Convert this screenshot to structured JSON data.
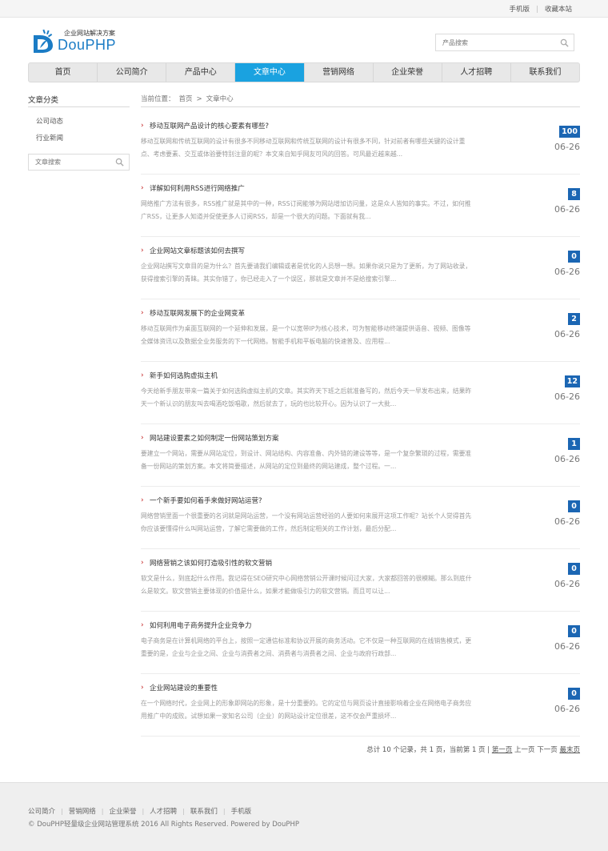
{
  "topbar": {
    "mobile": "手机版",
    "bookmark": "收藏本站"
  },
  "logo": {
    "tagline": "企业网站解决方案",
    "brand": "DouPHP"
  },
  "header_search": {
    "placeholder": "产品搜索"
  },
  "nav": [
    "首页",
    "公司简介",
    "产品中心",
    "文章中心",
    "营销网络",
    "企业荣誉",
    "人才招聘",
    "联系我们"
  ],
  "nav_active_index": 3,
  "sidebar": {
    "title": "文章分类",
    "items": [
      "公司动态",
      "行业新闻"
    ],
    "search_placeholder": "文章搜索"
  },
  "breadcrumb": {
    "prefix": "当前位置：",
    "home": "首页",
    "sep": ">",
    "current": "文章中心"
  },
  "articles": [
    {
      "title": "移动互联网产品设计的核心要素有哪些?",
      "desc": "移动互联网和传统互联网的设计有很多不同移动互联网和传统互联网的设计有很多不同，针对前者有哪些关键的设计重点、考虑要素、交互或体验要特别注意的呢？本文来自知乎网友可风的回答。可风最近越来越...",
      "count": "100",
      "date": "06-26"
    },
    {
      "title": "详解如何利用RSS进行网络推广",
      "desc": "网络推广方法有很多，RSS推广就是其中的一种，RSS订阅能够为网站增加访问量，这是众人皆知的事实。不过，如何推广RSS，让更多人知道并促使更多人订阅RSS，却是一个很大的问题。下面就有我...",
      "count": "8",
      "date": "06-26"
    },
    {
      "title": "企业网站文章标题该如何去撰写",
      "desc": "企业网站撰写文章目的是为什么？首先要请我们编辑或者是优化的人员想一想。如果你说只是为了更新，为了网站收录，获得搜索引擎的青睐。其实你错了，你已经走入了一个误区，那就是文章并不是给搜索引擎...",
      "count": "0",
      "date": "06-26"
    },
    {
      "title": "移动互联网发展下的企业网变革",
      "desc": "移动互联网作为桌面互联网的一个延伸和发展，是一个以宽带IP为核心技术，可为智能移动终端提供语音、视频、图像等全媒体资讯以及数据全业务服务的下一代网络。智能手机和平板电脑的快速普及、应用程...",
      "count": "2",
      "date": "06-26"
    },
    {
      "title": "新手如何选购虚拟主机",
      "desc": "今天给新手朋友带来一篇关于如何选购虚拟主机的文章。其实昨天下班之后就准备写的，然后今天一早发布出来，结果昨天一个新认识的朋友叫去喝酒吃饭唱歌，然后就去了，玩的也比较开心。因为认识了一大批...",
      "count": "12",
      "date": "06-26"
    },
    {
      "title": "网站建设要素之如何制定一份网站策划方案",
      "desc": "要建立一个网站，需要从网站定位，到设计、网站结构、内容准备、内外链的建设等等，是一个复杂繁琐的过程，需要准备一份网站的策划方案。本文将简要描述，从网站的定位到最终的网站建成，整个过程。一...",
      "count": "1",
      "date": "06-26"
    },
    {
      "title": "一个新手要如何着手来做好网站运营?",
      "desc": "网络营销里面一个很重要的名词就是网站运营，一个没有网站运营经验的人要如何来展开这项工作呢？站长个人觉得首先你应该要懂得什么叫网站运营，了解它需要做的工作，然后制定相关的工作计划，最后分配...",
      "count": "0",
      "date": "06-26"
    },
    {
      "title": "网络营销之该如何打造吸引性的软文营销",
      "desc": "软文是什么，到底起什么作用。我记得在SEO研究中心网络营销公开课时候问过大家，大家都回答的很模糊。那么到底什么是软文。软文营销主要体现的价值是什么，如果才能做吸引力的软文营销。而且可以让...",
      "count": "0",
      "date": "06-26"
    },
    {
      "title": "如何利用电子商务提升企业竞争力",
      "desc": "电子商务是在计算机网络的平台上，按照一定通信标准和协议开展的商务活动。它不仅是一种互联网的在线销售模式，更重要的是，企业与企业之间、企业与消费者之间、消费者与消费者之间、企业与政府行政部...",
      "count": "0",
      "date": "06-26"
    },
    {
      "title": "企业网站建设的重要性",
      "desc": "在一个网络时代，企业网上的形象即网站的形象，是十分重要的。它的定位与网页设计直接影响着企业在网络电子商务应用推广中的成败。试想如果一家知名公司（企业）的网站设计定位很差，这不仅会严重损坏...",
      "count": "0",
      "date": "06-26"
    }
  ],
  "pager": {
    "summary": "总计 10 个记录，共 1 页，当前第 1 页 |",
    "first": "第一页",
    "prev": "上一页",
    "next": "下一页",
    "last": "最末页"
  },
  "footer": {
    "links": [
      "公司简介",
      "营销网络",
      "企业荣誉",
      "人才招聘",
      "联系我们",
      "手机版"
    ],
    "copyright": "© DouPHP轻量级企业网站管理系统 2016 All Rights Reserved. Powered by DouPHP"
  },
  "colors": {
    "brand_blue": "#1b7cc5",
    "nav_active": "#1aa2e0",
    "badge_blue": "#1b66b3",
    "arrow_red": "#c01818"
  }
}
